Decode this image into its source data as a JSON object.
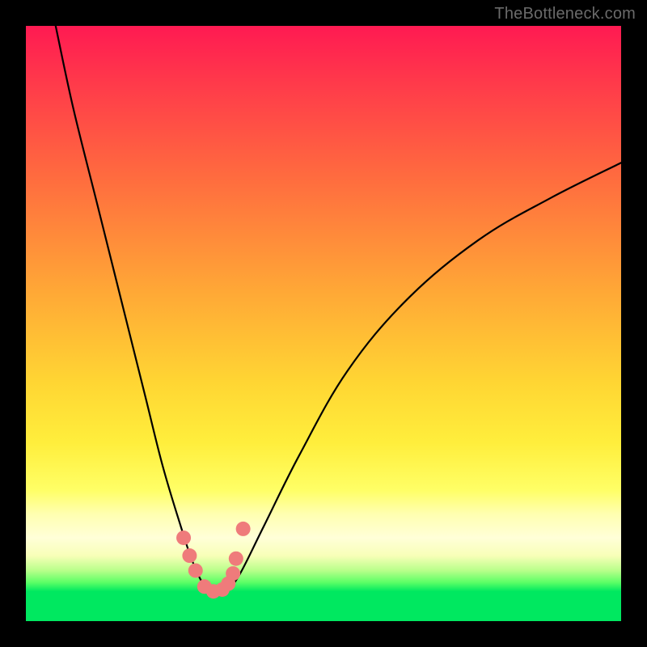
{
  "watermark": {
    "text": "TheBottleneck.com"
  },
  "colors": {
    "frame": "#000000",
    "curve": "#000000",
    "marker": "#ef7b7b",
    "gradient_top": "#ff1a52",
    "gradient_mid": "#ffd633",
    "gradient_low": "#ffffd8",
    "gradient_bottom": "#00e860"
  },
  "chart_data": {
    "type": "line",
    "title": "",
    "xlabel": "",
    "ylabel": "",
    "xlim": [
      0,
      100
    ],
    "ylim": [
      0,
      100
    ],
    "note": "No numeric axis labels are rendered in the image; values below are estimated from pixel geometry on a 0–100 normalized scale. Curve descends from (≈5, 100) to a flat minimum near x≈29–34, y≈5, then rises with diminishing slope toward (100, ≈77). Markers sit on the curve around the minimum.",
    "series": [
      {
        "name": "bottleneck-curve",
        "x": [
          5,
          8,
          12,
          16,
          20,
          23,
          26,
          28,
          30,
          32,
          34,
          36,
          40,
          46,
          54,
          64,
          76,
          88,
          100
        ],
        "y": [
          100,
          86,
          70,
          54,
          38,
          26,
          16,
          10,
          6,
          5,
          5.5,
          8,
          16,
          28,
          42,
          54,
          64,
          71,
          77
        ]
      }
    ],
    "markers": {
      "name": "highlight-points",
      "x": [
        26.5,
        27.5,
        28.5,
        30.0,
        31.5,
        33.0,
        34.0,
        34.8,
        35.3,
        36.5
      ],
      "y": [
        14.0,
        11.0,
        8.5,
        5.8,
        5.0,
        5.3,
        6.3,
        8.0,
        10.5,
        15.5
      ]
    }
  }
}
